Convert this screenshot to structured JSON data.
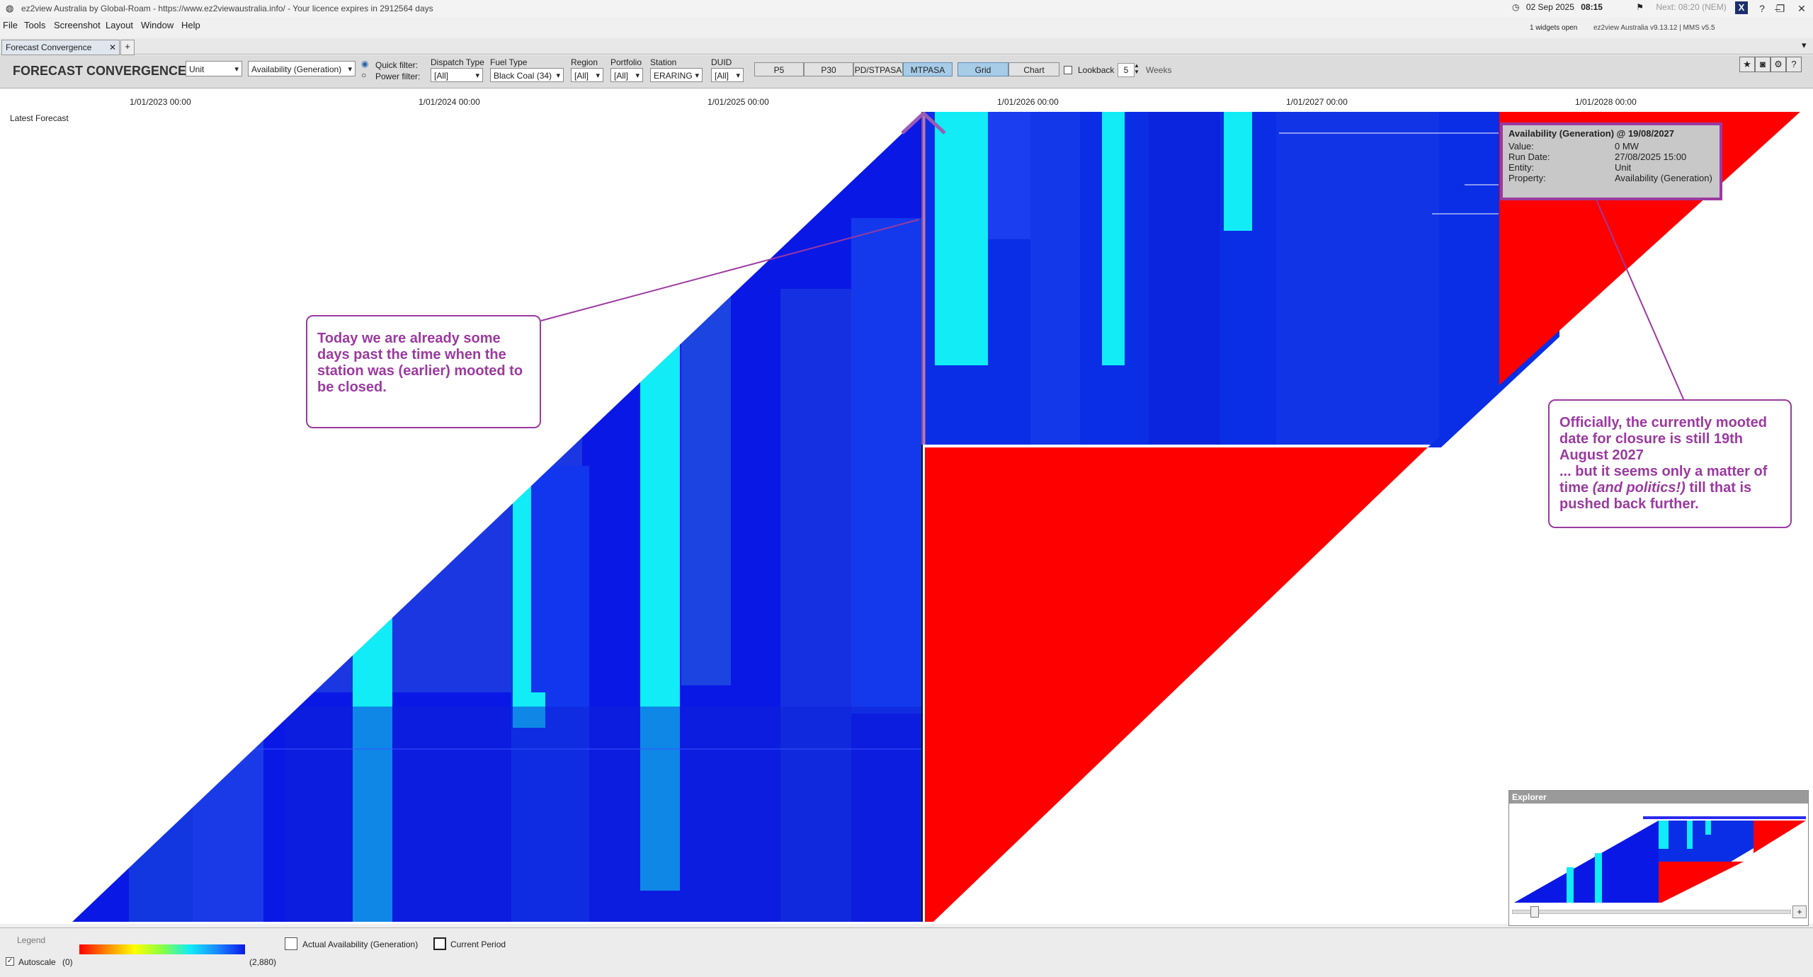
{
  "window": {
    "title": "ez2view Australia by Global-Roam - https://www.ez2viewaustralia.info/ - Your licence expires in 2912564 days",
    "date": "02 Sep 2025",
    "time": "08:15",
    "next": "Next: 08:20 (NEM)",
    "widgets_open": "1 widgets open",
    "version": "ez2view Australia v9.13.12 | MMS v5.5"
  },
  "menu": [
    "File",
    "Tools",
    "Screenshot",
    "Layout",
    "Window",
    "Help"
  ],
  "tab": {
    "label": "Forecast Convergence",
    "add": "+"
  },
  "toolbar": {
    "title": "FORECAST CONVERGENCE",
    "entity_select": "Unit",
    "property_select": "Availability (Generation)",
    "quick_filter": "Quick filter:",
    "power_filter": "Power filter:",
    "filters": [
      {
        "label": "Dispatch Type",
        "value": "[All]"
      },
      {
        "label": "Fuel Type",
        "value": "Black Coal (34)"
      },
      {
        "label": "Region",
        "value": "[All]"
      },
      {
        "label": "Portfolio",
        "value": "[All]"
      },
      {
        "label": "Station",
        "value": "ERARING"
      },
      {
        "label": "DUID",
        "value": "[All]"
      }
    ],
    "horizons": [
      "P5",
      "P30",
      "PD/STPASA",
      "MTPASA"
    ],
    "active_horizon": "MTPASA",
    "views": [
      "Grid",
      "Chart"
    ],
    "active_view": "Grid",
    "lookback_label": "Lookback",
    "lookback_value": "5",
    "lookback_unit": "Weeks"
  },
  "chart": {
    "row_label": "Latest Forecast",
    "x_ticks": [
      "1/01/2023 00:00",
      "1/01/2024 00:00",
      "1/01/2025 00:00",
      "1/01/2026 00:00",
      "1/01/2027 00:00",
      "1/01/2028 00:00"
    ]
  },
  "callouts": {
    "left": "Today we are already some days past the time when the station was (earlier) mooted to be closed.",
    "right_a": "Officially, the currently mooted date for closure is still 19th August 2027",
    "right_b": "... but it seems only a matter of time ",
    "right_em": "(and politics!)",
    "right_c": " till that is pushed back further."
  },
  "tooltip": {
    "title": "Availability (Generation) @ 19/08/2027",
    "rows": [
      {
        "k": "Value:",
        "v": "0 MW"
      },
      {
        "k": "Run Date:",
        "v": "27/08/2025 15:00"
      },
      {
        "k": "Entity:",
        "v": "Unit"
      },
      {
        "k": "Property:",
        "v": "Availability (Generation)"
      }
    ]
  },
  "explorer": {
    "title": "Explorer",
    "plus": "+"
  },
  "legend": {
    "title": "Legend",
    "autoscale": "Autoscale",
    "min": "(0)",
    "max": "(2,880)",
    "actual": "Actual Availability (Generation)",
    "current": "Current Period"
  }
}
